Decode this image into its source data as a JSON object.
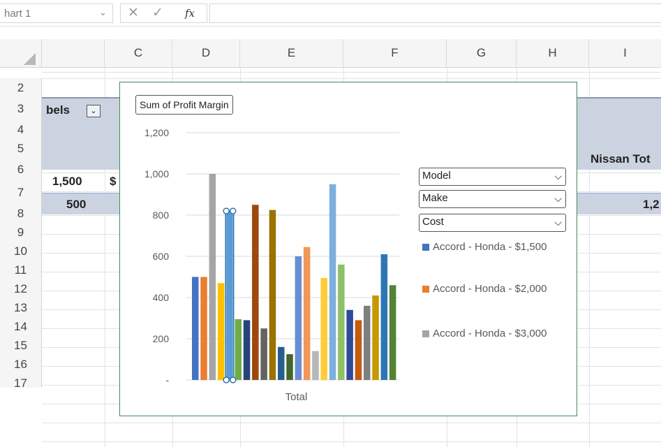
{
  "formula_bar": {
    "name_box": "hart 1",
    "cancel_icon": "✕",
    "enter_icon": "✓",
    "fx_label": "fx",
    "formula": ""
  },
  "columns": [
    "C",
    "D",
    "E",
    "F",
    "G",
    "H",
    "I"
  ],
  "rows": [
    "2",
    "3",
    "4",
    "5",
    "6",
    "7",
    "8",
    "9",
    "10",
    "11",
    "12",
    "13",
    "14",
    "15",
    "16",
    "17"
  ],
  "cells": {
    "b3": "bels",
    "b6": "1,500",
    "c6": "$",
    "b7": "500",
    "i5": "Nissan Tot",
    "i7": "1,2"
  },
  "chart": {
    "title_button": "Sum of Profit Margin",
    "filters": [
      "Model",
      "Make",
      "Cost"
    ],
    "legend": [
      {
        "label": "Accord - Honda - $1,500",
        "color": "#4472c4"
      },
      {
        "label": "Accord - Honda - $2,000",
        "color": "#ed7d31"
      },
      {
        "label": "Accord - Honda - $3,000",
        "color": "#a5a5a5"
      }
    ]
  },
  "chart_data": {
    "type": "bar",
    "categories": [
      "Total"
    ],
    "xlabel": "",
    "ylabel": "",
    "ylim": [
      0,
      1200
    ],
    "yticks": [
      "1,200",
      "1,000",
      "800",
      "600",
      "400",
      "200",
      "-"
    ],
    "values": [
      500,
      500,
      1000,
      470,
      820,
      295,
      290,
      850,
      250,
      825,
      160,
      125,
      600,
      645,
      140,
      495,
      950,
      560,
      340,
      290,
      360,
      410,
      610,
      460
    ],
    "colors": [
      "#4472c4",
      "#ed7d31",
      "#a5a5a5",
      "#ffc000",
      "#5b9bd5",
      "#70ad47",
      "#264478",
      "#9e480e",
      "#636363",
      "#997300",
      "#255e91",
      "#43682b",
      "#698ed0",
      "#f1975a",
      "#b7b7b7",
      "#ffcd33",
      "#7cafdd",
      "#8cc168",
      "#2f4b9a",
      "#c55a11",
      "#7f7f7f",
      "#c89800",
      "#2e75b6",
      "#548235"
    ],
    "selected_index": 4
  }
}
